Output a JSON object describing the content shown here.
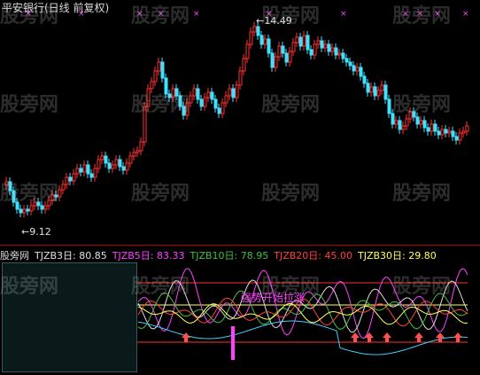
{
  "header": {
    "title": "平安银行(日线 前复权)"
  },
  "price_chart": {
    "high_label": "14.49",
    "low_label": "9.12",
    "up_color": "#ff3030",
    "down_color": "#40e0ff",
    "marker_color": "#ff40ff"
  },
  "indicator_bar": {
    "name": "股旁网",
    "items": [
      {
        "label": "TJZB3日:",
        "value": "80.85",
        "color": "#e0e0e0"
      },
      {
        "label": "TJZB5日:",
        "value": "83.33",
        "color": "#ff40ff"
      },
      {
        "label": "TJZB10日:",
        "value": "78.95",
        "color": "#40c040"
      },
      {
        "label": "TJZB20日:",
        "value": "45.00",
        "color": "#ff4040"
      },
      {
        "label": "TJZB30日:",
        "value": "29.80",
        "color": "#ffff60"
      }
    ]
  },
  "overlay_text": "强势开始拉涨",
  "watermark": "股旁网"
}
